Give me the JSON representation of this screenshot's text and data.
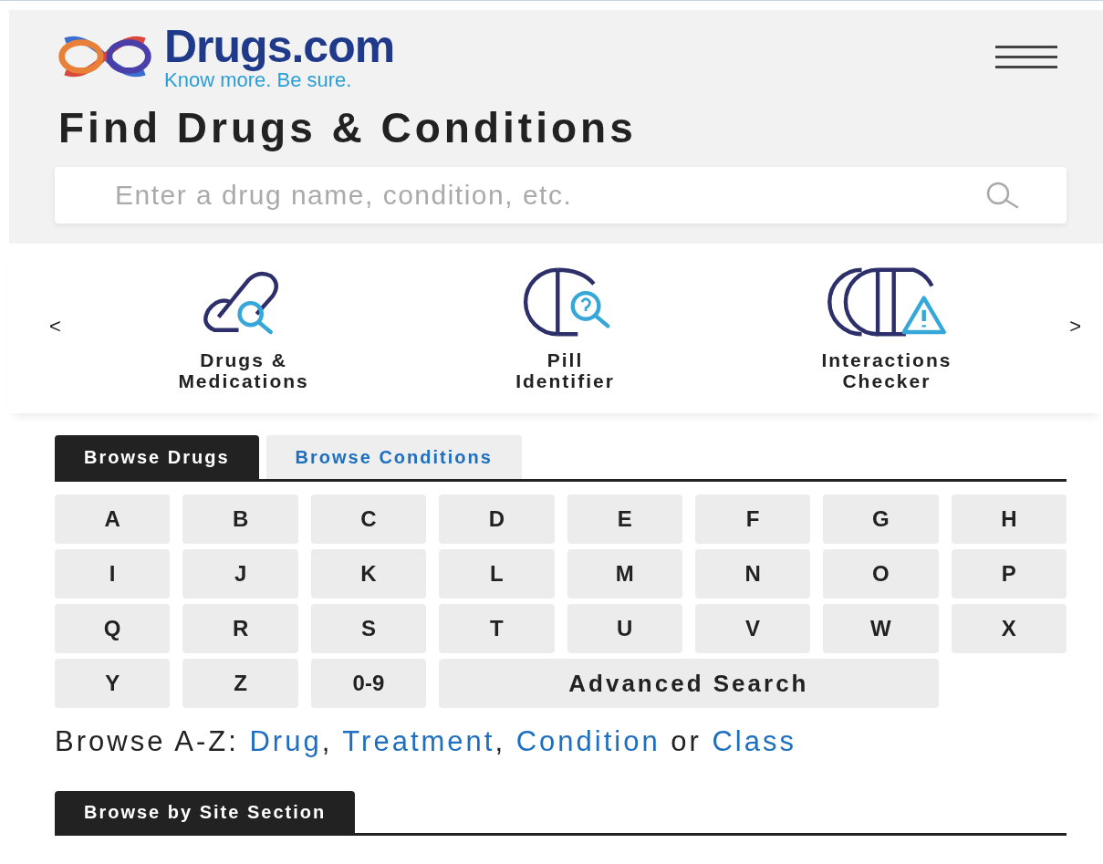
{
  "logo": {
    "name": "Drugs.com",
    "tagline": "Know more. Be sure."
  },
  "heading": "Find Drugs & Conditions",
  "search": {
    "placeholder": "Enter a drug name, condition, etc."
  },
  "carousel": {
    "prev": "<",
    "next": ">",
    "items": [
      {
        "kind": "pill-search",
        "label": "Drugs &\nMedications"
      },
      {
        "kind": "pill-question",
        "label": "Pill\nIdentifier"
      },
      {
        "kind": "pill-warning",
        "label": "Interactions\nChecker"
      }
    ]
  },
  "tabs": [
    {
      "label": "Browse Drugs",
      "selected": true
    },
    {
      "label": "Browse Conditions",
      "selected": false
    }
  ],
  "letters": [
    {
      "kind": "letter",
      "label": "A"
    },
    {
      "kind": "letter",
      "label": "B"
    },
    {
      "kind": "letter",
      "label": "C"
    },
    {
      "kind": "letter",
      "label": "D"
    },
    {
      "kind": "letter",
      "label": "E"
    },
    {
      "kind": "letter",
      "label": "F"
    },
    {
      "kind": "letter",
      "label": "G"
    },
    {
      "kind": "letter",
      "label": "H"
    },
    {
      "kind": "letter",
      "label": "I"
    },
    {
      "kind": "letter",
      "label": "J"
    },
    {
      "kind": "letter",
      "label": "K"
    },
    {
      "kind": "letter",
      "label": "L"
    },
    {
      "kind": "letter",
      "label": "M"
    },
    {
      "kind": "letter",
      "label": "N"
    },
    {
      "kind": "letter",
      "label": "O"
    },
    {
      "kind": "letter",
      "label": "P"
    },
    {
      "kind": "letter",
      "label": "Q"
    },
    {
      "kind": "letter",
      "label": "R"
    },
    {
      "kind": "letter",
      "label": "S"
    },
    {
      "kind": "letter",
      "label": "T"
    },
    {
      "kind": "letter",
      "label": "U"
    },
    {
      "kind": "letter",
      "label": "V"
    },
    {
      "kind": "letter",
      "label": "W"
    },
    {
      "kind": "letter",
      "label": "X"
    },
    {
      "kind": "letter",
      "label": "Y"
    },
    {
      "kind": "letter",
      "label": "Z"
    },
    {
      "kind": "letter",
      "label": "0-9"
    },
    {
      "kind": "wide",
      "label": "Advanced Search"
    }
  ],
  "browse_az": [
    {
      "kind": "text",
      "text": "Browse A-Z: "
    },
    {
      "kind": "link",
      "text": "Drug"
    },
    {
      "kind": "text",
      "text": ", "
    },
    {
      "kind": "link",
      "text": "Treatment"
    },
    {
      "kind": "text",
      "text": ", "
    },
    {
      "kind": "link",
      "text": "Condition"
    },
    {
      "kind": "text",
      "text": " or "
    },
    {
      "kind": "link",
      "text": "Class"
    }
  ],
  "section_tabs": [
    {
      "label": "Browse by Site Section",
      "selected": true
    }
  ]
}
